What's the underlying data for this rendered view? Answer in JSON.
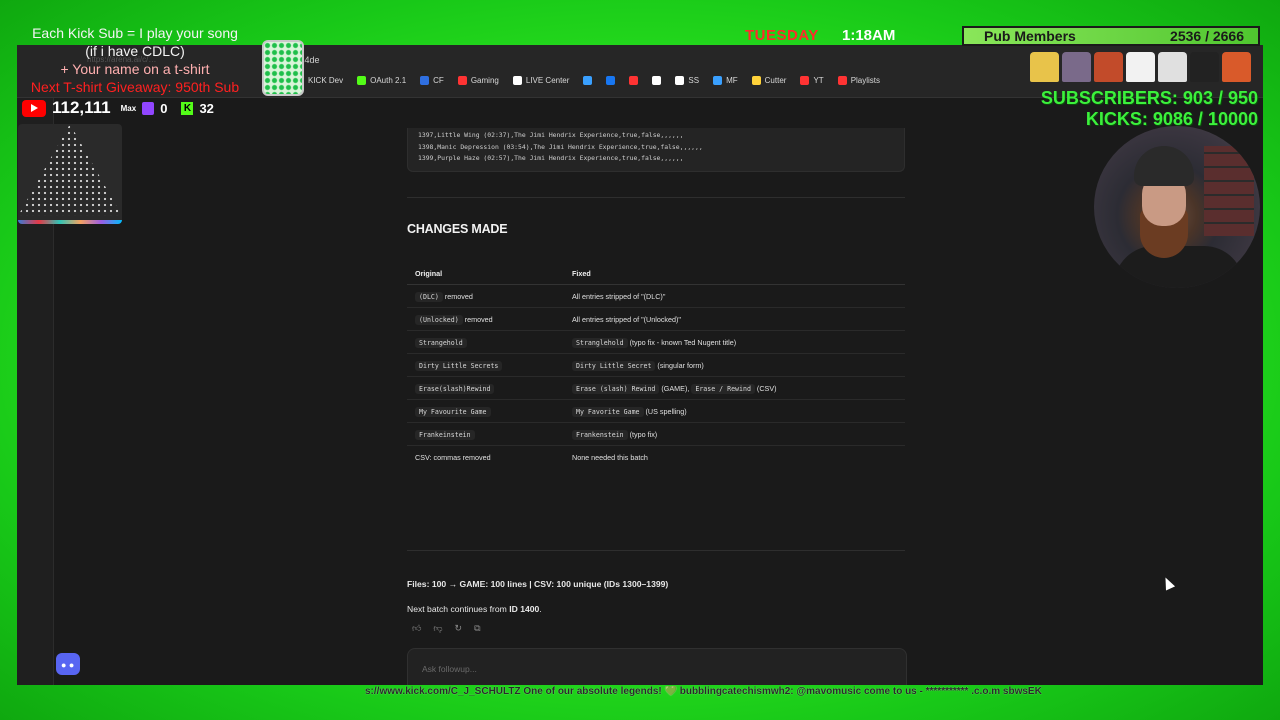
{
  "browser": {
    "url_fragment": "f14de",
    "bookmarks": [
      {
        "label": "KICK Dev",
        "icon": "kick-icon",
        "color": "#53fc18"
      },
      {
        "label": "OAuth 2.1",
        "icon": "kick-icon",
        "color": "#53fc18"
      },
      {
        "label": "CF",
        "icon": "cf-icon",
        "color": "#2f6fe0"
      },
      {
        "label": "Gaming",
        "icon": "youtube-icon",
        "color": "#ff3333"
      },
      {
        "label": "LIVE Center",
        "icon": "tiktok-icon",
        "color": "#ffffff"
      },
      {
        "label": "",
        "icon": "link-icon",
        "color": "#3aa0ff"
      },
      {
        "label": "",
        "icon": "facebook-icon",
        "color": "#1877f2"
      },
      {
        "label": "",
        "icon": "youtube-icon",
        "color": "#ff3333"
      },
      {
        "label": "",
        "icon": "x-icon",
        "color": "#ffffff"
      },
      {
        "label": "SS",
        "icon": "tiktok-icon",
        "color": "#ffffff"
      },
      {
        "label": "MF",
        "icon": "mf-icon",
        "color": "#3aa0ff"
      },
      {
        "label": "Cutter",
        "icon": "cutter-icon",
        "color": "#ffd23a"
      },
      {
        "label": "YT",
        "icon": "youtube-icon",
        "color": "#ff3333"
      },
      {
        "label": "Playlists",
        "icon": "youtube-icon",
        "color": "#ff3333"
      }
    ]
  },
  "code": {
    "lines": [
      "1397,Little Wing (02:37),The Jimi Hendrix Experience,true,false,,,,,,",
      "1398,Manic Depression (03:54),The Jimi Hendrix Experience,true,false,,,,,,",
      "1399,Purple Haze (02:57),The Jimi Hendrix Experience,true,false,,,,,,"
    ]
  },
  "changes": {
    "heading": "CHANGES MADE",
    "columns": [
      "Original",
      "Fixed"
    ],
    "rows": [
      {
        "orig_code": "(DLC)",
        "orig_text": " removed",
        "fix_code": "",
        "fix_text": "All entries stripped of \"(DLC)\""
      },
      {
        "orig_code": "(Unlocked)",
        "orig_text": " removed",
        "fix_code": "",
        "fix_text": "All entries stripped of \"(Unlocked)\""
      },
      {
        "orig_code": "Strangehold",
        "orig_text": "",
        "fix_code": "Stranglehold",
        "fix_text": " (typo fix - known Ted Nugent title)"
      },
      {
        "orig_code": "Dirty Little Secrets",
        "orig_text": "",
        "fix_code": "Dirty Little Secret",
        "fix_text": " (singular form)"
      },
      {
        "orig_code": "Erase(slash)Rewind",
        "orig_text": "",
        "fix_code": "Erase (slash) Rewind",
        "fix_text": " (GAME), ",
        "fix_code2": "Erase / Rewind",
        "fix_text2": " (CSV)"
      },
      {
        "orig_code": "My Favourite Game",
        "orig_text": "",
        "fix_code": "My Favorite Game",
        "fix_text": " (US spelling)"
      },
      {
        "orig_code": "Frankeinstein",
        "orig_text": "",
        "fix_code": "Frankenstein",
        "fix_text": " (typo fix)"
      },
      {
        "orig_code": "",
        "orig_text": "CSV: commas removed",
        "fix_code": "",
        "fix_text": "None needed this batch"
      }
    ]
  },
  "summary": {
    "files": "Files: 100 → GAME: 100 lines | CSV: 100 unique (IDs 1300–1399)",
    "next_prefix": "Next batch continues from ",
    "next_id": "ID 1400",
    "next_suffix": "."
  },
  "ask": {
    "placeholder": "Ask followup..."
  },
  "overlay": {
    "line1": "Each Kick Sub = I play your song",
    "line2": "(if i have CDLC)",
    "line3": "+ Your name on a t-shirt",
    "line4": "Next T-shirt Giveaway: 950th Sub",
    "yt_count": "112,111",
    "max_label": "Max",
    "twitch_count": "0",
    "kick_count": "32",
    "day": "TUESDAY",
    "time": "1:18AM",
    "pub_label": "Pub Members",
    "pub_value": "2536 / 2666",
    "subscribers": "SUBSCRIBERS: 903 / 950",
    "kicks": "KICKS: 9086 / 10000",
    "ticker": "s://www.kick.com/C_J_SCHULTZ One of our absolute legends! 💚    bubblingcatechismwh2: @mavomusic come to us - *********** .c.o.m sbwsEK"
  }
}
